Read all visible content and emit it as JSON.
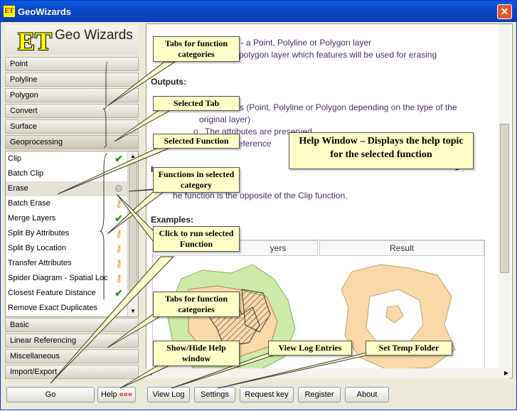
{
  "window": {
    "title": "GeoWizards",
    "app_icon": "ET",
    "close_symbol": "✕"
  },
  "logo": {
    "et": "ET",
    "name": "Geo Wizards"
  },
  "top_tabs": [
    "Point",
    "Polyline",
    "Polygon",
    "Convert",
    "Surface",
    "Geoprocessing"
  ],
  "selected_tab": "Geoprocessing",
  "functions": [
    {
      "label": "Clip",
      "icon": "check-icon"
    },
    {
      "label": "Batch Clip",
      "icon": ""
    },
    {
      "label": "Erase",
      "icon": "gear-icon"
    },
    {
      "label": "Batch Erase",
      "icon": "key-icon"
    },
    {
      "label": "Merge Layers",
      "icon": "check-icon"
    },
    {
      "label": "Split By Attributes",
      "icon": "key-icon"
    },
    {
      "label": "Split By Location",
      "icon": "key-icon"
    },
    {
      "label": "Transfer Attributes",
      "icon": "key-icon"
    },
    {
      "label": "Spider Diagram - Spatial Loc",
      "icon": "key-icon"
    },
    {
      "label": "Closest Feature Distance",
      "icon": "check-icon"
    },
    {
      "label": "Remove Exact Duplicates",
      "icon": "key-icon"
    }
  ],
  "selected_function": "Erase",
  "bottom_tabs": [
    "Basic",
    "Linear Referencing",
    "Miscellaneous",
    "Import/Export"
  ],
  "buttons": {
    "go": "Go",
    "help": "Help",
    "help_arrows": "«««",
    "view_log": "View Log",
    "settings": "Settings",
    "request_key": "Request key",
    "register": "Register",
    "about": "About"
  },
  "help": {
    "line1": "sed  - a Point, Polyline or Polygon layer",
    "line2": "polygon layer which features will be used for erasing",
    "outputs_heading": "Outputs:",
    "line3": "ss (Point, Polyline or Polygon depending on the type of the",
    "line4": "original layer)",
    "bullet": "o",
    "line5": "The attributes are preserved",
    "line6": "al reference",
    "heading_partial": "I",
    "line7": "he function is the opposite of the Clip function.",
    "examples_heading": "Examples:",
    "col_layers": "yers",
    "col_result": "Result"
  },
  "callouts": {
    "tabs_top": "Tabs for function categories",
    "selected_tab": "Selected Tab",
    "selected_function": "Selected Function",
    "functions_in_category": "Functions in selected category",
    "click_to_run": "Click to run selected Function",
    "tabs_bottom": "Tabs for function categories",
    "show_hide_help": "Show/Hide Help window",
    "view_log": "View Log Entries",
    "temp_folder": "Set Temp Folder",
    "help_window": "Help Window – Displays the help topic for the selected function"
  }
}
